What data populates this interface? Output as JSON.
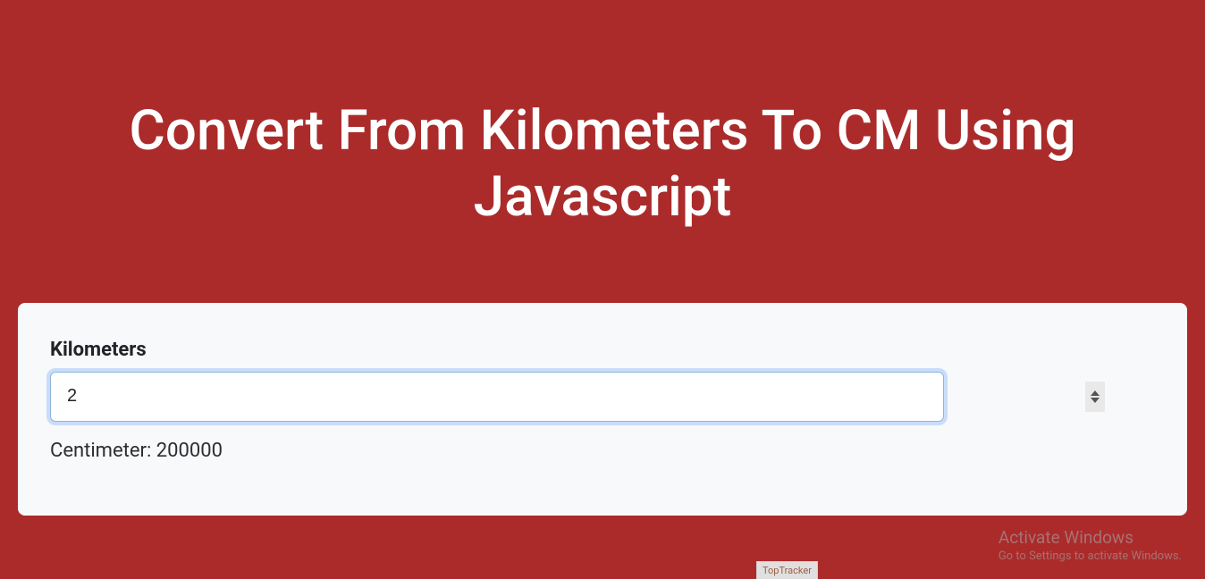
{
  "header": {
    "title": "Convert From Kilometers To CM Using Javascript"
  },
  "form": {
    "label": "Kilometers",
    "value": "2",
    "result_label": "Centimeter:",
    "result_value": "200000"
  },
  "watermark": {
    "line1": "Activate Windows",
    "line2": "Go to Settings to activate Windows."
  },
  "tray": {
    "toptracker": "TopTracker"
  }
}
